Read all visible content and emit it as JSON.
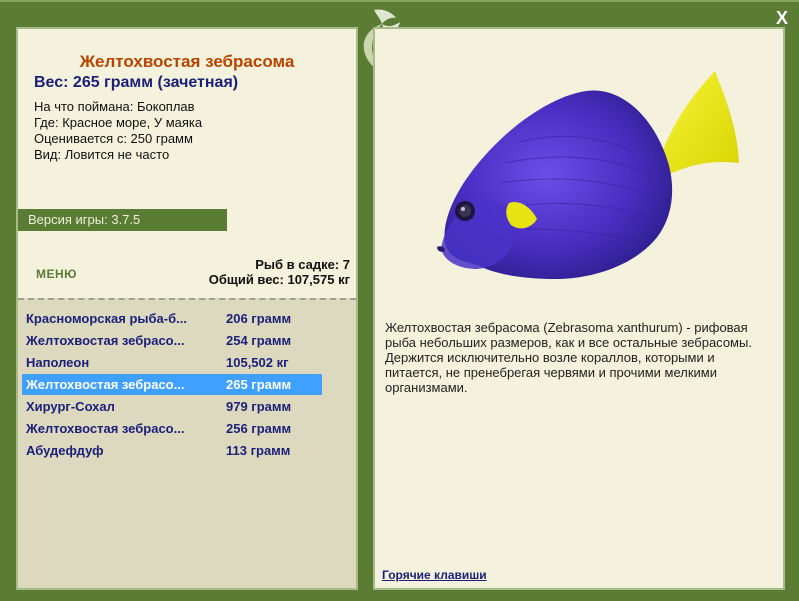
{
  "window": {
    "close_label": "X"
  },
  "fish": {
    "title": "Желтохвостая зебрасома",
    "weight_line": "Вес: 265 грамм (зачетная)",
    "info": [
      "На что поймана: Бокоплав",
      "Где: Красное море, У маяка",
      "Оценивается с: 250 грамм",
      "Вид: Ловится не часто"
    ],
    "description": "Желтохвостая зебрасома (Zebrasoma xanthurum) - рифовая рыба небольших размеров, как и все остальные зебрасомы. Держится исключительно возле кораллов, которыми и питается, не пренебрегая червями и прочими мелкими организмами."
  },
  "version": "Версия игры: 3.7.5",
  "menu_label": "МЕНЮ",
  "cage": {
    "count": "Рыб в садке: 7",
    "total": "Общий вес: 107,575 кг"
  },
  "catches": [
    {
      "name": "Красноморская рыба-б...",
      "weight": "206 грамм",
      "selected": false
    },
    {
      "name": "Желтохвостая зебрасо...",
      "weight": "254 грамм",
      "selected": false
    },
    {
      "name": "Наполеон",
      "weight": "105,502 кг",
      "selected": false
    },
    {
      "name": "Желтохвостая зебрасо...",
      "weight": "265 грамм",
      "selected": true
    },
    {
      "name": "Хирург-Сохал",
      "weight": "979 грамм",
      "selected": false
    },
    {
      "name": "Желтохвостая зебрасо...",
      "weight": "256 грамм",
      "selected": false
    },
    {
      "name": "Абудефдуф",
      "weight": "113 грамм",
      "selected": false
    }
  ],
  "hotkeys_label": "Горячие клавиши",
  "icons": {
    "close": "close-icon",
    "leaf": "leaf-ornament-icon",
    "fish": "fish-image"
  },
  "colors": {
    "frame_green": "#5b7c33",
    "panel_cream": "#f4f2dc",
    "title_orange": "#b84400",
    "text_navy": "#1a1f7a",
    "selection_blue": "#3fa0ff",
    "fish_purple": "#5a3ad0",
    "fish_yellow": "#f0ee10"
  }
}
